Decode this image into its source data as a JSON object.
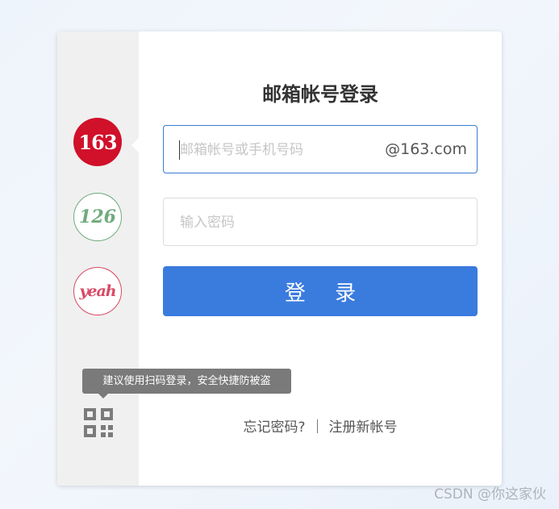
{
  "tooltip": {
    "text": "建议使用扫码登录，安全快捷防被盗"
  },
  "brands": [
    {
      "label": "163",
      "color": "#d1102a"
    },
    {
      "label": "126",
      "color": "#6fab7e"
    },
    {
      "label": "yeah",
      "color": "#d84a65"
    }
  ],
  "form": {
    "title": "邮箱帐号登录",
    "account_placeholder": "邮箱帐号或手机号码",
    "account_value": "",
    "account_suffix": "@163.com",
    "password_placeholder": "输入密码",
    "password_value": "",
    "login_label": "登 录",
    "forgot_label": "忘记密码?",
    "register_label": "注册新帐号"
  },
  "watermark": "CSDN @你这家伙",
  "colors": {
    "primary": "#3a7bde",
    "brand163": "#d1102a",
    "brand126": "#6fab7e",
    "brandYeah": "#d84a65"
  },
  "icons": {
    "qr": "qr-code-icon"
  }
}
